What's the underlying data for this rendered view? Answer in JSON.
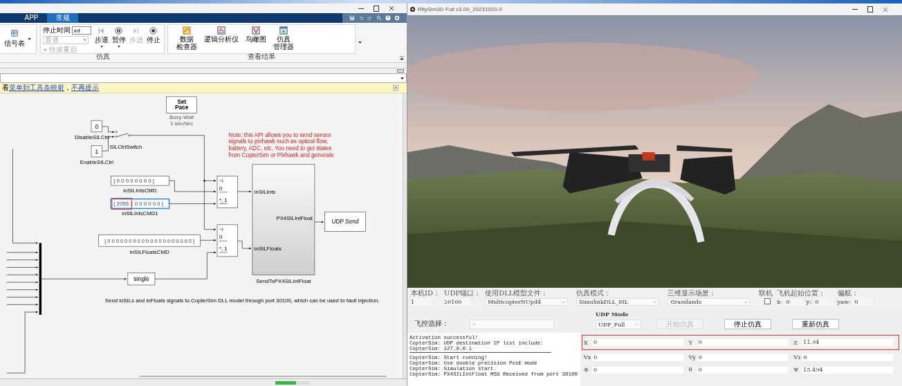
{
  "matlab": {
    "tabs": [
      {
        "label": "APP",
        "selected": false
      },
      {
        "label": "常规",
        "selected": true
      }
    ],
    "ribbon": {
      "signal_table": "信号表",
      "stop_time_label": "停止时间",
      "stop_time": "inf",
      "mode": {
        "value": "普通",
        "disabled": true
      },
      "fast_restart": {
        "label": "快速重启",
        "disabled": true
      },
      "sim_buttons": [
        {
          "label": "步退",
          "kind": "step-back",
          "disabled": false,
          "menu": true
        },
        {
          "label": "暂停",
          "kind": "pause",
          "disabled": false,
          "menu": true
        },
        {
          "label": "步进",
          "kind": "step-forward",
          "disabled": true,
          "menu": false
        },
        {
          "label": "停止",
          "kind": "stop",
          "disabled": false,
          "menu": false
        }
      ],
      "sim_section": "仿真",
      "result_buttons": [
        {
          "lines": [
            "数据",
            "检查器"
          ],
          "kind": "inspector"
        },
        {
          "lines": [
            "逻辑分析仪"
          ],
          "kind": "analyzer"
        },
        {
          "lines": [
            "鸟瞰图"
          ],
          "kind": "birdseye"
        },
        {
          "lines": [
            "仿真",
            "管理器"
          ],
          "kind": "manager"
        }
      ],
      "results_section": "查看结果"
    },
    "info_bar": {
      "prefix": "看",
      "link": "菜单到工具条映射",
      "separator": "，",
      "link2": "不再提示"
    },
    "diagram": {
      "set_pace": {
        "lines": [
          "Set",
          "Pace"
        ],
        "caption": [
          "Busy-Wait",
          "1 sec/sec"
        ]
      },
      "disable_const": {
        "value": "0",
        "label": "DisableSILCtrl"
      },
      "enable_const": {
        "value": "1",
        "label": "EnableSILCtrl"
      },
      "switch_label": "SILCtrlSwitch",
      "note_lines": [
        "Note: this API allows you to send sensor",
        "signals to pixhawk such as optical flow,",
        "battery, ADC, etc. You need to get states",
        "from CopterSim or Pixhawk and generate"
      ],
      "ints_cmd": {
        "value": "[ 0 0 0 0 0 0 0 0 ]",
        "label": "inSILIntsCMD",
        "selected": false,
        "annotated": false
      },
      "ints_cmd1": {
        "value": "[ 2055 1 0 0 0 0 0 0 ]",
        "label": "inSILIntsCMD1",
        "selected": true,
        "annotated": true
      },
      "switches": [
        {
          "ports": [
            "0",
            "*, 1"
          ]
        },
        {
          "ports": [
            "0",
            "*, 1"
          ]
        }
      ],
      "subsystem": {
        "inputs": [
          "inSILInts",
          "inSILFloats"
        ],
        "output": "PX4SILIntFloat",
        "label": "SendToPX4SILIntFloat"
      },
      "udp_send": "UDP Send",
      "floats_cmd": {
        "value": "[ 0 0 0 0 0 0 0 0 0 0 0 0 0 0 0 0 0 0 0 0 ]",
        "label": "inSILFloatsCMD"
      },
      "convert": "single",
      "caption": "Send inSILs and inFloats signals to CopterSim DLL model through port 30100, which can be used to fault injection."
    },
    "status_bar": {
      "progress": {
        "level": 0.6
      }
    }
  },
  "rflysim": {
    "title": "RflySim3D Full v3.00_20231020-0",
    "config": [
      {
        "label": "本机ID：",
        "kind": "text",
        "value": "1"
      },
      {
        "label": "UDP端口：",
        "kind": "text",
        "value": "20100"
      },
      {
        "label": "使用DLL模型文件：",
        "kind": "select",
        "value": "MulticopterNUpd4"
      },
      {
        "label": "仿真模式：",
        "kind": "select",
        "value": "SimulinkDLL_SIL"
      },
      {
        "label": "三维显示场景：",
        "kind": "select",
        "value": "Grasslands"
      },
      {
        "label": "联机",
        "kind": "checkbox",
        "checked": false
      },
      {
        "label": "飞机起始位置：",
        "kind": "coords",
        "coords": [
          {
            "label": "x:",
            "value": "0"
          },
          {
            "label": "y:",
            "value": "0"
          }
        ]
      },
      {
        "label": "偏航：",
        "kind": "coords",
        "coords": [
          {
            "label": "yaw:",
            "value": "0"
          }
        ]
      }
    ],
    "controller_label": "飞控选择：",
    "udp_mode_label": "UDP Mode",
    "udp_mode": "UDP_Full",
    "buttons": [
      {
        "label": "开始仿真",
        "disabled": true
      },
      {
        "label": "停止仿真",
        "disabled": false
      },
      {
        "label": "重新仿真",
        "disabled": false
      }
    ],
    "log_groups": [
      [
        "Activation successful!",
        "CopterSim: UDP destination IP list include:",
        "CopterSim: 127.0.0.1"
      ],
      [
        "CopterSim: Start running!",
        "CopterSim: Use double precision PosE mode",
        "CopterSim: Simulation start.",
        "CopterSim: PX4SILIntFloat MSG Received from port 30100"
      ]
    ],
    "state_rows": [
      {
        "annotated": true,
        "fields": [
          {
            "label": "X",
            "value": "0"
          },
          {
            "label": "Y",
            "value": "0"
          },
          {
            "label": "Z",
            "value": "11.94"
          }
        ]
      },
      {
        "annotated": false,
        "fields": [
          {
            "label": "Vx",
            "value": "0"
          },
          {
            "label": "Vy",
            "value": "0"
          },
          {
            "label": "Vz",
            "value": "0"
          }
        ]
      },
      {
        "annotated": false,
        "fields": [
          {
            "label": "Φ",
            "value": "0"
          },
          {
            "label": "θ",
            "value": "0"
          },
          {
            "label": "Ψ",
            "value": "15.494"
          }
        ]
      }
    ]
  }
}
